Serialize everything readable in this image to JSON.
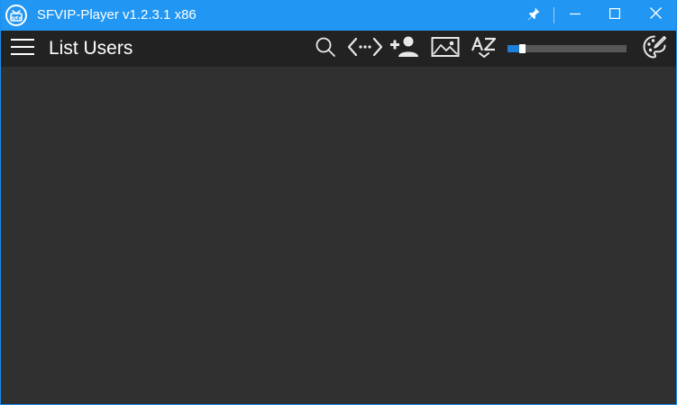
{
  "window": {
    "title": "SFVIP-Player v1.2.3.1 x86",
    "accent_color": "#2196f3"
  },
  "titlebar_buttons": {
    "pin_icon": "pin-icon",
    "minimize_icon": "minimize-icon",
    "maximize_icon": "maximize-icon",
    "close_icon": "close-icon"
  },
  "toolbar": {
    "menu_icon": "hamburger-menu-icon",
    "title": "List Users",
    "search_icon": "search-icon",
    "code_icon": "code-brackets-icon",
    "add_user_icon": "add-user-icon",
    "image_icon": "image-icon",
    "sort_icon": "sort-az-icon",
    "theme_icon": "palette-icon"
  },
  "zoom_slider": {
    "value_fraction": 0.1,
    "fill_color": "#1f7fd6",
    "track_color": "#58585a"
  },
  "content": {
    "background_color": "#303030"
  }
}
